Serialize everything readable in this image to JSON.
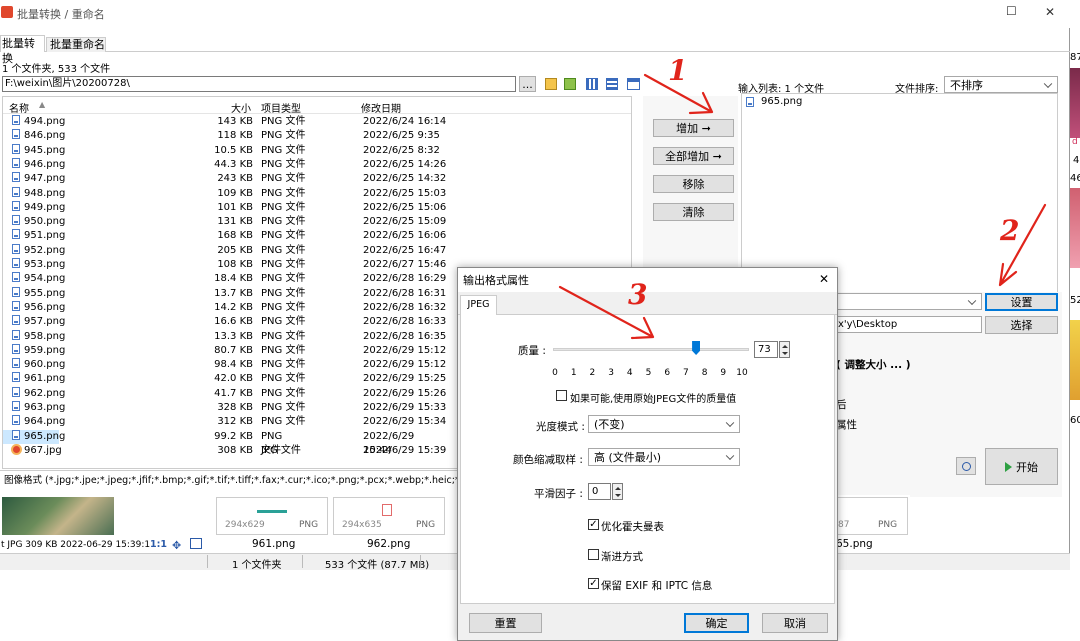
{
  "window": {
    "title": "批量转换 / 重命名",
    "minimize": "☐",
    "close": "✕"
  },
  "tabs": [
    {
      "label": "批量转换"
    },
    {
      "label": "批量重命名"
    }
  ],
  "summary": "1 个文件夹, 533 个文件",
  "path": "F:\\weixin\\图片\\20200728\\",
  "path_btn": "...",
  "columns": {
    "name": "名称",
    "size": "大小",
    "type": "项目类型",
    "date": "修改日期"
  },
  "files": [
    {
      "name": "494.png",
      "size": "143 KB",
      "type": "PNG 文件",
      "date": "2022/6/24 16:14"
    },
    {
      "name": "846.png",
      "size": "118 KB",
      "type": "PNG 文件",
      "date": "2022/6/25 9:35"
    },
    {
      "name": "945.png",
      "size": "10.5 KB",
      "type": "PNG 文件",
      "date": "2022/6/25 8:32"
    },
    {
      "name": "946.png",
      "size": "44.3 KB",
      "type": "PNG 文件",
      "date": "2022/6/25 14:26"
    },
    {
      "name": "947.png",
      "size": "243 KB",
      "type": "PNG 文件",
      "date": "2022/6/25 14:32"
    },
    {
      "name": "948.png",
      "size": "109 KB",
      "type": "PNG 文件",
      "date": "2022/6/25 15:03"
    },
    {
      "name": "949.png",
      "size": "101 KB",
      "type": "PNG 文件",
      "date": "2022/6/25 15:06"
    },
    {
      "name": "950.png",
      "size": "131 KB",
      "type": "PNG 文件",
      "date": "2022/6/25 15:09"
    },
    {
      "name": "951.png",
      "size": "168 KB",
      "type": "PNG 文件",
      "date": "2022/6/25 16:06"
    },
    {
      "name": "952.png",
      "size": "205 KB",
      "type": "PNG 文件",
      "date": "2022/6/25 16:47"
    },
    {
      "name": "953.png",
      "size": "108 KB",
      "type": "PNG 文件",
      "date": "2022/6/27 15:46"
    },
    {
      "name": "954.png",
      "size": "18.4 KB",
      "type": "PNG 文件",
      "date": "2022/6/28 16:29"
    },
    {
      "name": "955.png",
      "size": "13.7 KB",
      "type": "PNG 文件",
      "date": "2022/6/28 16:31"
    },
    {
      "name": "956.png",
      "size": "14.2 KB",
      "type": "PNG 文件",
      "date": "2022/6/28 16:32"
    },
    {
      "name": "957.png",
      "size": "16.6 KB",
      "type": "PNG 文件",
      "date": "2022/6/28 16:33"
    },
    {
      "name": "958.png",
      "size": "13.3 KB",
      "type": "PNG 文件",
      "date": "2022/6/28 16:35"
    },
    {
      "name": "959.png",
      "size": "80.7 KB",
      "type": "PNG 文件",
      "date": "2022/6/29 15:12"
    },
    {
      "name": "960.png",
      "size": "98.4 KB",
      "type": "PNG 文件",
      "date": "2022/6/29 15:12"
    },
    {
      "name": "961.png",
      "size": "42.0 KB",
      "type": "PNG 文件",
      "date": "2022/6/29 15:25"
    },
    {
      "name": "962.png",
      "size": "41.7 KB",
      "type": "PNG 文件",
      "date": "2022/6/29 15:26"
    },
    {
      "name": "963.png",
      "size": "328 KB",
      "type": "PNG 文件",
      "date": "2022/6/29 15:33"
    },
    {
      "name": "964.png",
      "size": "312 KB",
      "type": "PNG 文件",
      "date": "2022/6/29 15:34"
    },
    {
      "name": "965.png",
      "size": "99.2 KB",
      "type": "PNG 文件",
      "date": "2022/6/29 15:44",
      "selected": true
    },
    {
      "name": "967.jpg",
      "size": "308 KB",
      "type": "JPG 文件",
      "date": "2022/6/29 15:39",
      "jpg": true
    }
  ],
  "filter": "图像格式 (*.jpg;*.jpe;*.jpeg;*.jfif;*.bmp;*.gif;*.tif;*.tiff;*.fax;*.cur;*.ico;*.png;*.pcx;*.webp;*.heic;*.heif",
  "middle_buttons": {
    "add": "增加 ➞",
    "add_all": "全部增加 ➞",
    "remove": "移除",
    "clear": "清除"
  },
  "input_list": {
    "label": "输入列表: 1 个文件",
    "sort_label": "文件排序:",
    "sort_value": "不排序",
    "items": [
      "965.png"
    ]
  },
  "right_panel": {
    "settings": "设置",
    "select": "选择",
    "out_path": "x'y\\Desktop",
    "resize_label": "( 调整大小 ... )",
    "char1": "后",
    "props": "属性",
    "start": "开始"
  },
  "thumbs": {
    "dims1": "294x629",
    "fmt1": "PNG",
    "dims2": "294x635",
    "fmt2": "PNG",
    "dims3": "87",
    "fmt3": "PNG",
    "name1": "961.png",
    "name2": "962.png",
    "name3": "65.png",
    "info": "t JPG  309 KB  2022-06-29 15:39:1",
    "ratio": "1:1"
  },
  "status": {
    "folders": "1 个文件夹",
    "files": "533 个文件 (87.7 MB)"
  },
  "dialog": {
    "title": "输出格式属性",
    "close": "✕",
    "tab": "JPEG",
    "quality_label": "质量 :",
    "quality_value": "73",
    "quality_level": 0.73,
    "ticks": [
      "0",
      "1",
      "2",
      "3",
      "4",
      "5",
      "6",
      "7",
      "8",
      "9",
      "10"
    ],
    "use_original": "如果可能,使用原始JPEG文件的质量值",
    "luminance_label": "光度模式 :",
    "luminance_value": "(不变)",
    "subsample_label": "颜色缩减取样 :",
    "subsample_value": "高 (文件最小)",
    "smooth_label": "平滑因子 :",
    "smooth_value": "0",
    "huffman": "优化霍夫曼表",
    "progressive": "渐进方式",
    "keep_exif": "保留 EXIF 和 IPTC 信息",
    "reset": "重置",
    "ok": "确定",
    "cancel": "取消",
    "check_mark": "✓"
  },
  "annotations": {
    "n1": "1",
    "n2": "2",
    "n3": "3",
    "color": "#e0241b"
  },
  "edge": {
    "e1": "87",
    "e2": "4",
    "e3": "46",
    "e4": "52",
    "e5": "60",
    "e6": "d"
  }
}
